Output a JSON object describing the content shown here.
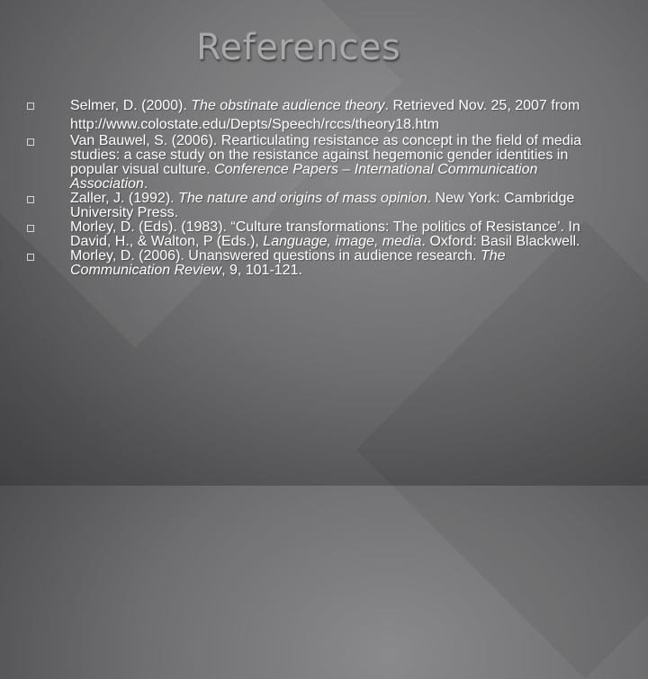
{
  "title": "References",
  "references": [
    {
      "parts": [
        {
          "text": "Selmer, D. (2000). ",
          "italic": false
        },
        {
          "text": "The obstinate audience theory",
          "italic": true
        },
        {
          "text": ". Retrieved Nov. 25, 2007 from http://www.colostate.edu/Depts/Speech/rccs/theory18.htm",
          "italic": false
        }
      ]
    },
    {
      "parts": [
        {
          "text": "Van Bauwel, S. (2006). Rearticulating resistance as concept in the field of media studies: a case study on the resistance against hegemonic gender identities in popular visual culture. ",
          "italic": false
        },
        {
          "text": "Conference Papers – International Communication Association",
          "italic": true
        },
        {
          "text": ".",
          "italic": false
        }
      ]
    },
    {
      "parts": [
        {
          "text": "Zaller, J. (1992). ",
          "italic": false
        },
        {
          "text": "The nature and origins of mass opinion",
          "italic": true
        },
        {
          "text": ". New York: Cambridge University Press.",
          "italic": false
        }
      ]
    },
    {
      "parts": [
        {
          "text": "Morley, D. (Eds).  (1983). “Culture transformations: The politics of Resistance’. In David, H., & Walton, P (Eds.), ",
          "italic": false
        },
        {
          "text": "Language, image, media",
          "italic": true
        },
        {
          "text": ". Oxford: Basil Blackwell.",
          "italic": false
        }
      ]
    },
    {
      "parts": [
        {
          "text": "Morley, D. (2006). Unanswered questions in audience research. ",
          "italic": false
        },
        {
          "text": "The Communication Review",
          "italic": true
        },
        {
          "text": ", 9, 101-121.",
          "italic": false
        }
      ]
    }
  ]
}
